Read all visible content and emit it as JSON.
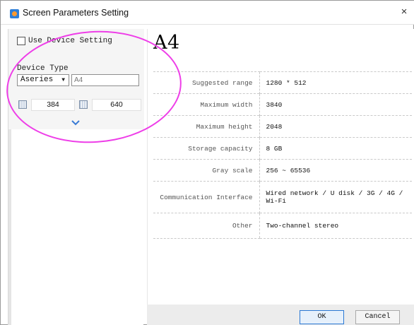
{
  "window": {
    "title": "Screen Parameters Setting",
    "close_glyph": "×",
    "app_icon": "screen-app-icon"
  },
  "left": {
    "use_device_setting_label": "Use Device Setting",
    "use_device_setting_checked": false,
    "device_type_label": "Device Type",
    "series_value": "Aseries",
    "model_value": "A4",
    "width_value": "384",
    "height_value": "640"
  },
  "right": {
    "model_title": "A4",
    "specs": [
      {
        "label": "Suggested range",
        "value": "1280 * 512"
      },
      {
        "label": "Maximum width",
        "value": "3840"
      },
      {
        "label": "Maximum height",
        "value": "2048"
      },
      {
        "label": "Storage capacity",
        "value": "8 GB"
      },
      {
        "label": "Gray scale",
        "value": "256 ~ 65536"
      },
      {
        "label": "Communication Interface",
        "value": "Wired network / U disk / 3G / 4G / Wi-Fi"
      },
      {
        "label": "Other",
        "value": "Two-channel stereo"
      }
    ]
  },
  "buttons": {
    "ok_label": "OK",
    "cancel_label": "Cancel"
  },
  "colors": {
    "highlight": "#ee3ee8",
    "accent": "#2a78d4",
    "chevron": "#3a7bd5"
  }
}
